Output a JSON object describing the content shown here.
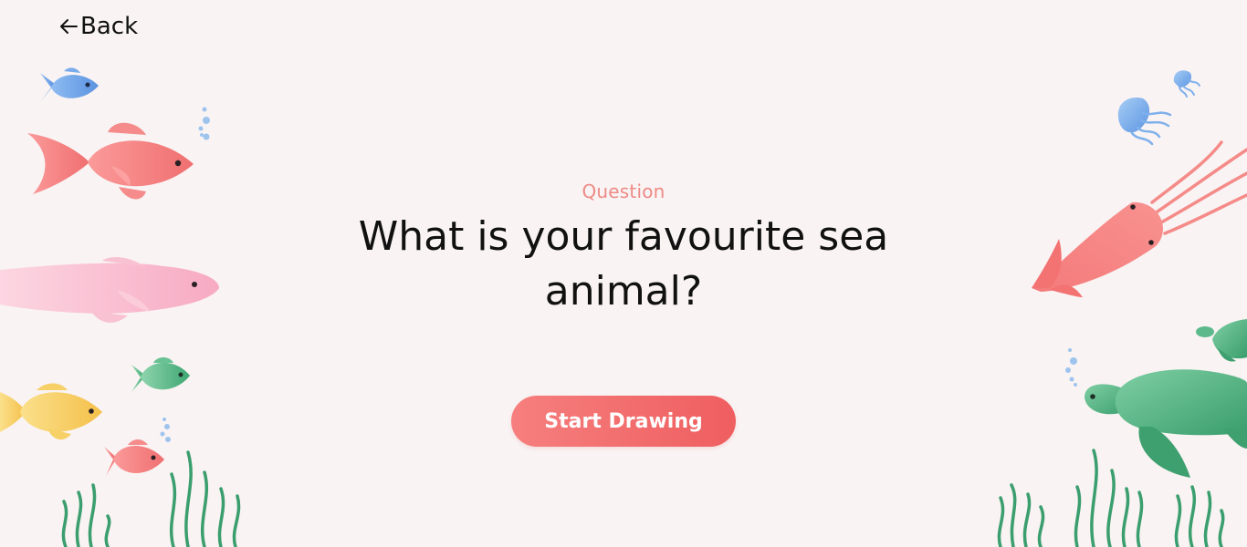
{
  "nav": {
    "back_label": "Back",
    "back_icon": "arrow-left-icon"
  },
  "prompt": {
    "eyebrow": "Question",
    "question": "What is your favourite sea animal?"
  },
  "cta": {
    "label": "Start Drawing"
  },
  "colors": {
    "background": "#f9f3f3",
    "accent": "#ef6a6b",
    "eyebrow": "#ee8a86",
    "fish_blue": "#6ea6ea",
    "fish_red": "#f47b7b",
    "fish_pink": "#f9b9cd",
    "fish_green": "#5cb98b",
    "fish_yellow": "#f8cc5e",
    "seaweed": "#3b9e6e",
    "bubbles": "#9ec4ee"
  },
  "decorations": {
    "left": [
      "blue-fish",
      "red-fish",
      "pink-fish",
      "green-fish",
      "yellow-fish",
      "small-red-fish",
      "seaweed",
      "bubbles"
    ],
    "right": [
      "jellyfish",
      "squid",
      "sea-turtle",
      "seaweed",
      "bubbles"
    ]
  }
}
